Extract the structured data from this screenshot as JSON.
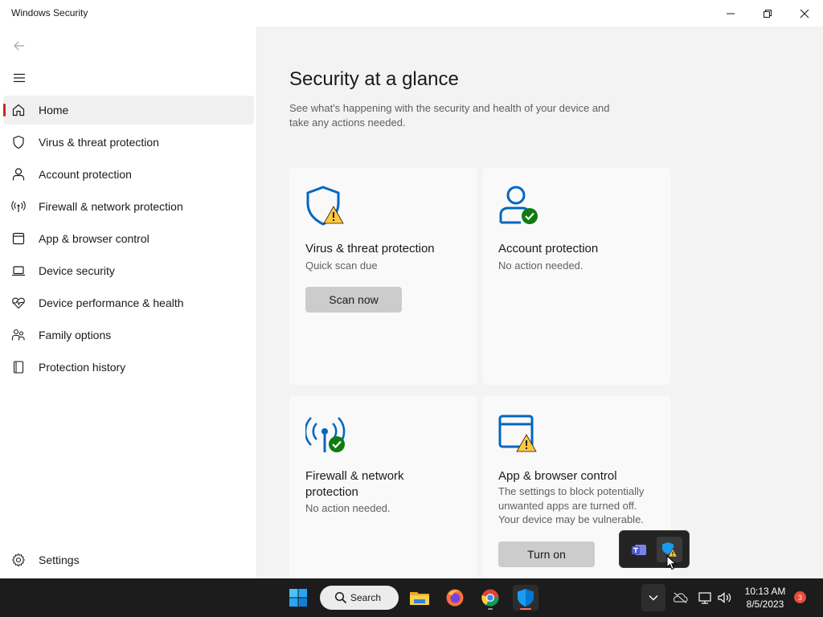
{
  "window": {
    "title": "Windows Security"
  },
  "sidebar": {
    "items": [
      {
        "label": "Home",
        "icon": "home-icon",
        "active": true
      },
      {
        "label": "Virus & threat protection",
        "icon": "shield-icon"
      },
      {
        "label": "Account protection",
        "icon": "person-icon"
      },
      {
        "label": "Firewall & network protection",
        "icon": "antenna-icon"
      },
      {
        "label": "App & browser control",
        "icon": "browser-window-icon"
      },
      {
        "label": "Device security",
        "icon": "laptop-icon"
      },
      {
        "label": "Device performance & health",
        "icon": "heart-pulse-icon"
      },
      {
        "label": "Family options",
        "icon": "family-icon"
      },
      {
        "label": "Protection history",
        "icon": "history-icon"
      }
    ],
    "settings_label": "Settings"
  },
  "main": {
    "title": "Security at a glance",
    "subtitle": "See what's happening with the security and health of your device and take any actions needed.",
    "tiles": [
      {
        "title": "Virus & threat protection",
        "status": "Quick scan due",
        "button": "Scan now",
        "status_color": "#ffc83d"
      },
      {
        "title": "Account protection",
        "status": "No action needed.",
        "status_color": "#107c10"
      },
      {
        "title": "Firewall & network protection",
        "status": "No action needed.",
        "status_color": "#107c10"
      },
      {
        "title": "App & browser control",
        "status": "The settings to block potentially unwanted apps are turned off. Your device may be vulnerable.",
        "button": "Turn on",
        "status_color": "#ffc83d"
      }
    ]
  },
  "taskbar": {
    "search_label": "Search",
    "clock_time": "10:13 AM",
    "clock_date": "8/5/2023",
    "notification_count": "3",
    "accent": "#0067c0"
  }
}
